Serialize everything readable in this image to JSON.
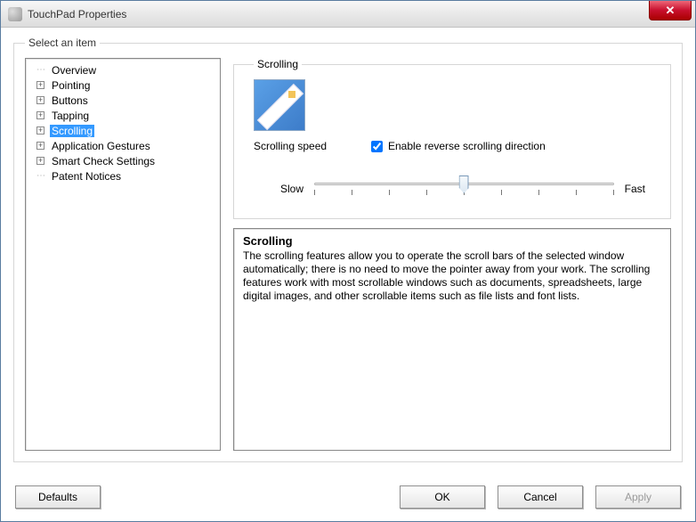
{
  "window": {
    "title": "TouchPad Properties"
  },
  "outer_legend": "Select an item",
  "tree": {
    "items": [
      {
        "label": "Overview",
        "expandable": false
      },
      {
        "label": "Pointing",
        "expandable": true
      },
      {
        "label": "Buttons",
        "expandable": true
      },
      {
        "label": "Tapping",
        "expandable": true
      },
      {
        "label": "Scrolling",
        "expandable": true,
        "selected": true
      },
      {
        "label": "Application Gestures",
        "expandable": true
      },
      {
        "label": "Smart Check Settings",
        "expandable": true
      },
      {
        "label": "Patent Notices",
        "expandable": false
      }
    ]
  },
  "scrolling": {
    "legend": "Scrolling",
    "speed_label": "Scrolling speed",
    "checkbox_label": "Enable reverse scrolling direction",
    "checkbox_checked": true,
    "slow_label": "Slow",
    "fast_label": "Fast"
  },
  "description": {
    "title": "Scrolling",
    "body": "The scrolling features allow you to operate the scroll bars of the selected window automatically; there is no need to move the pointer away from your work. The scrolling features work with most scrollable windows such as documents, spreadsheets, large digital images, and other scrollable items such as file lists and font lists."
  },
  "buttons": {
    "defaults": "Defaults",
    "ok": "OK",
    "cancel": "Cancel",
    "apply": "Apply"
  }
}
